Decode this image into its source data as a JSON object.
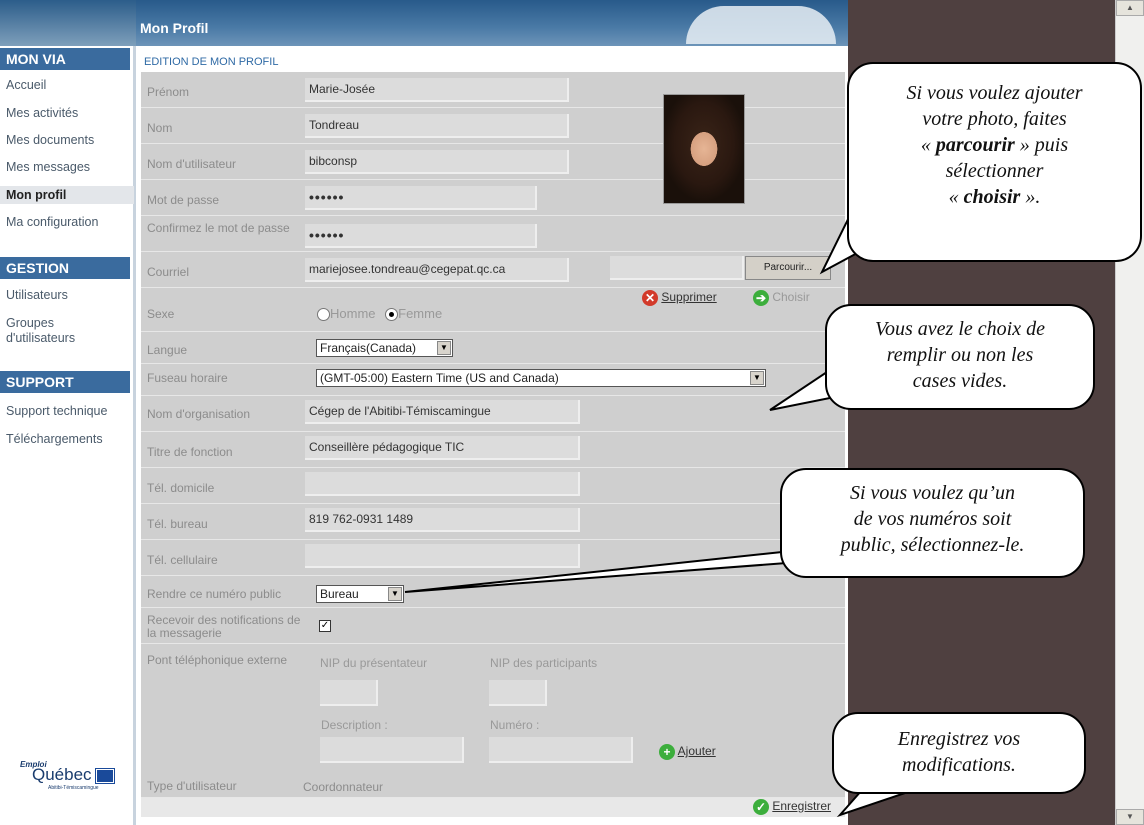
{
  "header": {
    "title": "Mon Profil"
  },
  "sidebar": {
    "sections": [
      {
        "title": "MON VIA",
        "items": [
          "Accueil",
          "Mes activités",
          "Mes documents",
          "Mes messages",
          "Mon profil",
          "Ma configuration"
        ]
      },
      {
        "title": "GESTION",
        "items": [
          "Utilisateurs",
          "Groupes d'utilisateurs"
        ]
      },
      {
        "title": "SUPPORT",
        "items": [
          "Support technique",
          "Téléchargements"
        ]
      }
    ],
    "active": "Mon profil",
    "logo": {
      "small": "Emploi",
      "main": "Québec",
      "sub": "Abitibi-Témiscamingue"
    }
  },
  "form": {
    "title": "EDITION DE MON PROFIL",
    "prenom": {
      "label": "Prénom",
      "value": "Marie-Josée"
    },
    "nom": {
      "label": "Nom",
      "value": "Tondreau"
    },
    "username": {
      "label": "Nom d'utilisateur",
      "value": "bibconsp"
    },
    "password": {
      "label": "Mot de passe",
      "value": "••••••"
    },
    "confirm": {
      "label": "Confirmez le mot de passe",
      "value": "••••••"
    },
    "courriel": {
      "label": "Courriel",
      "value": "mariejosee.tondreau@cegepat.qc.ca"
    },
    "sexe": {
      "label": "Sexe",
      "option1": "Homme",
      "option2": "Femme",
      "selected": "Femme"
    },
    "langue": {
      "label": "Langue",
      "value": "Français(Canada)"
    },
    "fuseau": {
      "label": "Fuseau horaire",
      "value": "(GMT-05:00) Eastern Time (US and Canada)"
    },
    "organisation": {
      "label": "Nom d'organisation",
      "value": "Cégep de l'Abitibi-Témiscamingue"
    },
    "titre": {
      "label": "Titre de fonction",
      "value": "Conseillère pédagogique TIC"
    },
    "tel_domicile": {
      "label": "Tél. domicile",
      "value": ""
    },
    "tel_bureau": {
      "label": "Tél. bureau",
      "value": "819 762-0931 1489"
    },
    "tel_cellulaire": {
      "label": "Tél. cellulaire",
      "value": ""
    },
    "public_num": {
      "label": "Rendre ce numéro public",
      "value": "Bureau"
    },
    "notifications": {
      "label": "Recevoir des notifications de la messagerie",
      "checked": true
    },
    "pont": {
      "label": "Pont téléphonique externe",
      "nip_presentateur": "NIP du présentateur",
      "nip_participants": "NIP des participants",
      "description": "Description :",
      "numero": "Numéro :",
      "add": "Ajouter"
    },
    "type": {
      "label": "Type d'utilisateur",
      "value": "Coordonnateur"
    },
    "photo": {
      "browse": "Parcourir...",
      "delete": "Supprimer",
      "choose": "Choisir"
    },
    "save": "Enregistrer"
  },
  "callouts": {
    "photo": {
      "line1": "Si vous voulez ajouter",
      "line2": "votre photo, faites",
      "line3a": "« ",
      "line3b": "parcourir",
      "line3c": " » puis",
      "line4": "sélectionner",
      "line5a": "« ",
      "line5b": "choisir",
      "line5c": " »."
    },
    "empty": {
      "line1": "Vous avez le choix de",
      "line2": "remplir ou non les",
      "line3": "cases vides."
    },
    "public": {
      "line1": "Si vous voulez qu’un",
      "line2": "de vos numéros soit",
      "line3": "public, sélectionnez-le."
    },
    "save": {
      "line1": "Enregistrez vos",
      "line2": "modifications."
    }
  },
  "colors": {
    "nav_header": "#3a6b9e",
    "link_blue": "#2f6aa5",
    "right_panel": "#4f4040",
    "form_bg": "#cfcfcf"
  }
}
